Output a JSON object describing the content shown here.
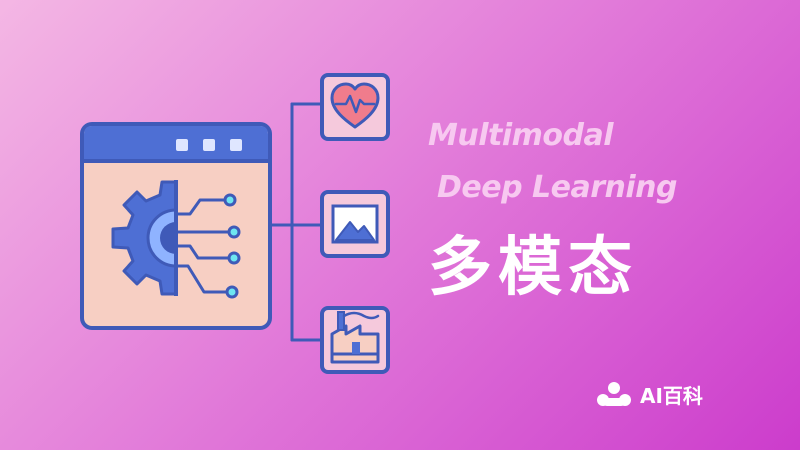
{
  "subtitle": {
    "line1": "Multimodal",
    "line2": "Deep Learning"
  },
  "title": "多模态",
  "brand": {
    "name": "AI百科",
    "icon": "brand-logo-icon"
  },
  "icons": {
    "window": "browser-window-icon",
    "gear": "gear-ai-icon",
    "heart": "heart-pulse-icon",
    "image": "image-icon",
    "factory": "factory-icon"
  },
  "colors": {
    "background_start": "#f4b7e4",
    "background_end": "#cc3ccc",
    "outline": "#3f5ab8",
    "window_body": "#f7cfc3",
    "tile_fill": "#f5c9dc",
    "node_fill": "#6ee6f0",
    "subtitle": "#f7c9f0",
    "title": "#ffffff"
  }
}
